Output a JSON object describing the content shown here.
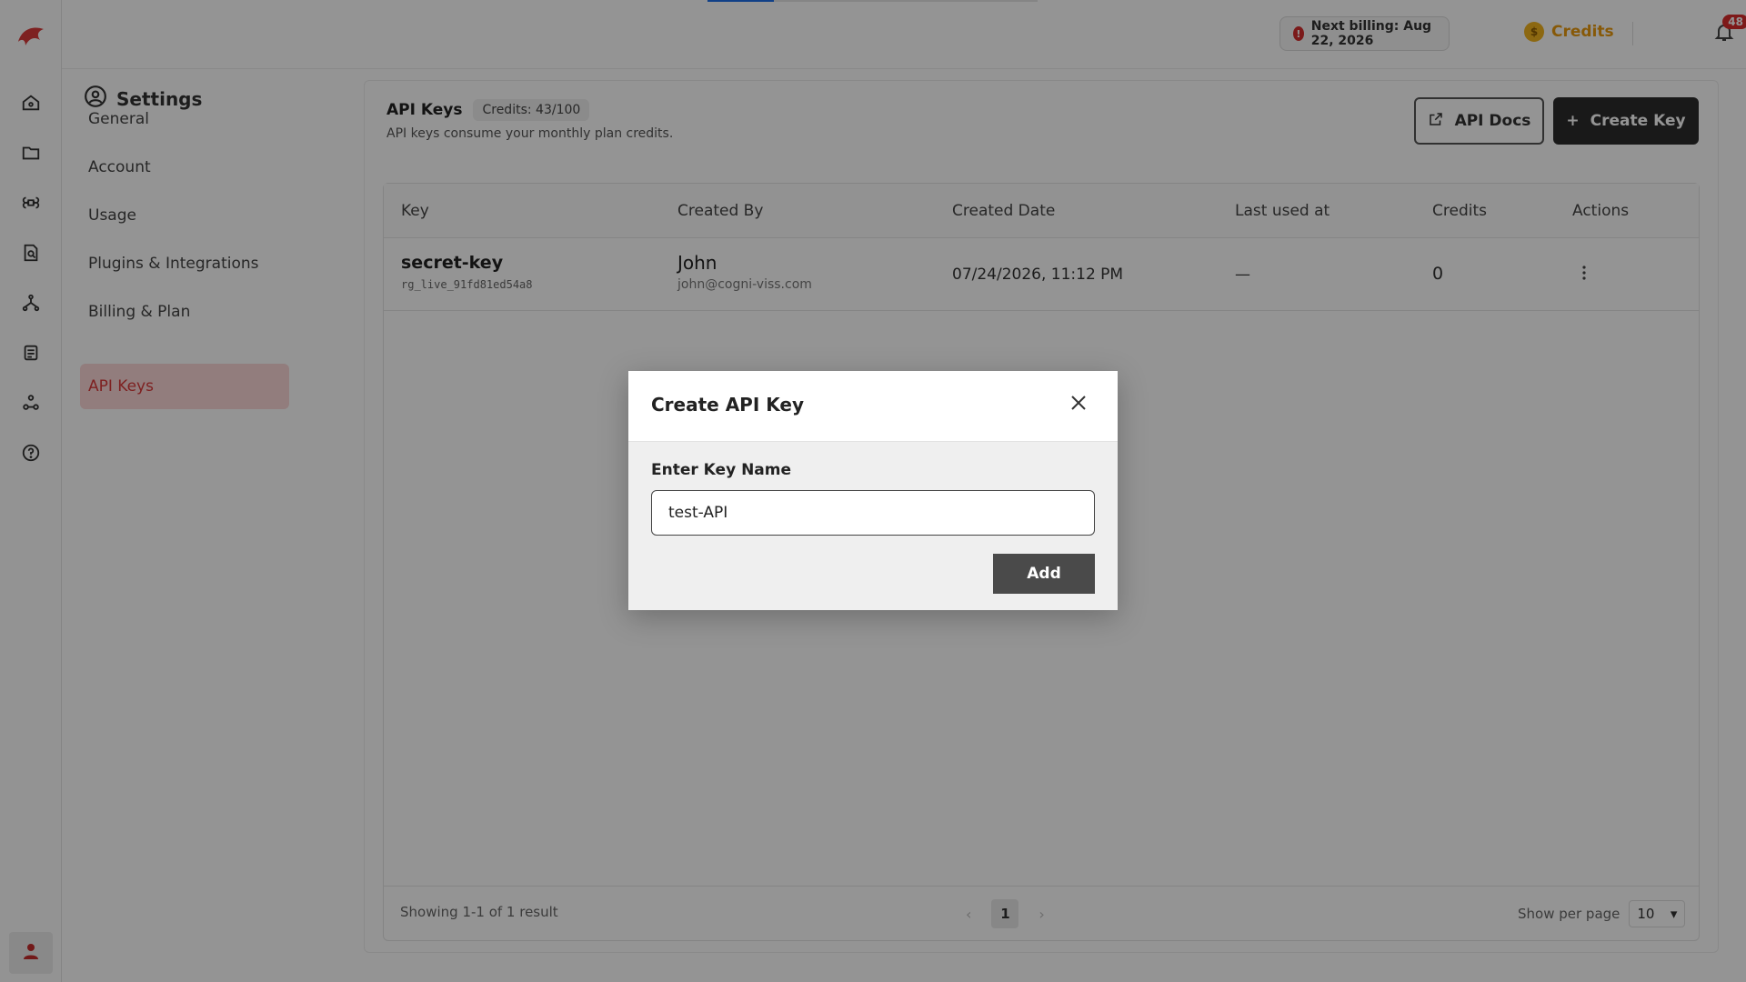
{
  "header": {
    "billing_text": "Next billing: Aug 22, 2026",
    "billing_icon": "alert-circle-icon",
    "credits_label": "Credits",
    "credits_icon": "coin-icon",
    "notifications_count": "48",
    "loading_progress": 0.2
  },
  "rail": {
    "icons": [
      "home-icon",
      "folder-icon",
      "command-icon",
      "document-search-icon",
      "workflow-icon",
      "list-icon",
      "network-icon",
      "help-icon"
    ],
    "user_icon": "user-icon"
  },
  "settings": {
    "title": "Settings",
    "items": [
      {
        "label": "General"
      },
      {
        "label": "Account"
      },
      {
        "label": "Usage"
      },
      {
        "label": "Plugins & Integrations"
      },
      {
        "label": "Billing & Plan"
      },
      {
        "label": "API Keys",
        "active": true
      }
    ]
  },
  "main": {
    "title": "API Keys",
    "credits_badge": "Credits: 43/100",
    "subtitle": "API keys consume your monthly plan credits.",
    "docs_button": "API Docs",
    "create_button": "Create Key",
    "table": {
      "columns": [
        "Key",
        "Created By",
        "Created Date",
        "Last used at",
        "Credits",
        "Actions"
      ],
      "rows": [
        {
          "key_name": "secret-key",
          "key_id": "rg_live_91fd81ed54a8",
          "creator_name": "John",
          "creator_email": "john@cogni-viss.com",
          "created_date": "07/24/2026, 11:12 PM",
          "last_used": "—",
          "credits": "0"
        }
      ],
      "showing": "Showing 1-1 of 1 result",
      "current_page": "1",
      "per_page_label": "Show per page",
      "per_page_value": "10"
    }
  },
  "modal": {
    "title": "Create API Key",
    "field_label": "Enter Key Name",
    "field_value": "test-API",
    "add_button": "Add"
  },
  "colors": {
    "accent_red": "#d93a3a",
    "credits_orange": "#e8990e",
    "dark_button": "#2b2b2b"
  }
}
